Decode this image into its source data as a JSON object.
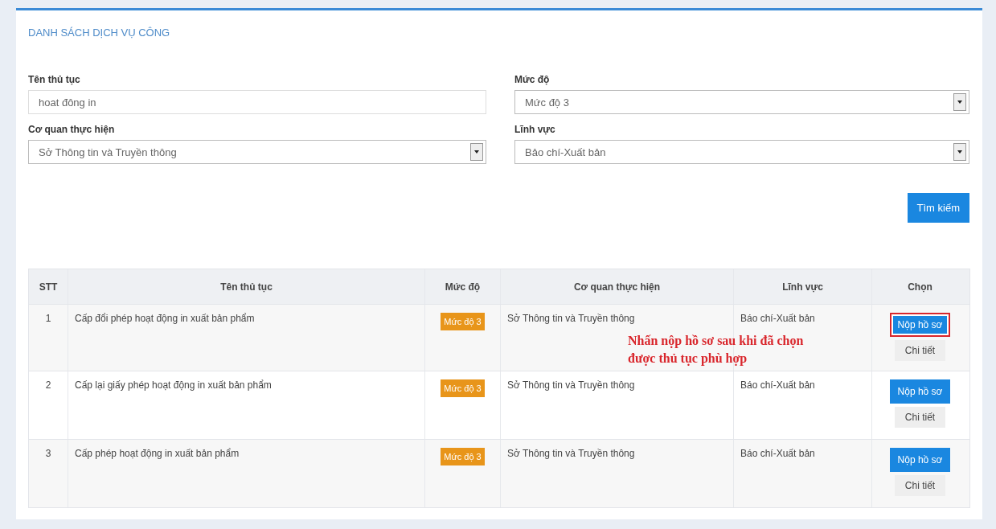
{
  "panel": {
    "title": "DANH SÁCH DỊCH VỤ CÔNG"
  },
  "filters": [
    {
      "label": "Tên thủ tục",
      "kind": "text",
      "value": "hoat đông in"
    },
    {
      "label": "Mức độ",
      "kind": "select",
      "value": "Mức độ 3"
    },
    {
      "label": "Cơ quan thực hiện",
      "kind": "select",
      "value": "Sở Thông tin và Truyền thông"
    },
    {
      "label": "Lĩnh vực",
      "kind": "select",
      "value": "Bảo chí-Xuất bản"
    }
  ],
  "search_button": "Tìm kiếm",
  "table": {
    "columns": [
      "STT",
      "Tên thủ tục",
      "Mức độ",
      "Cơ quan thực hiện",
      "Lĩnh vực",
      "Chọn"
    ],
    "rows": [
      {
        "stt": "1",
        "name": "Cấp đổi phép hoạt động in xuất bản phẩm",
        "level": "Mức độ 3",
        "agency": "Sở Thông tin và Truyền thông",
        "field": "Báo chí-Xuất bản",
        "submit": "Nộp hồ sơ",
        "detail": "Chi tiết",
        "highlighted": true
      },
      {
        "stt": "2",
        "name": "Cấp lại giấy phép hoạt động in xuất bản phẩm",
        "level": "Mức độ 3",
        "agency": "Sở Thông tin và Truyền thông",
        "field": "Báo chí-Xuất bản",
        "submit": "Nộp hồ sơ",
        "detail": "Chi tiết",
        "highlighted": false
      },
      {
        "stt": "3",
        "name": "Cấp phép hoạt động in xuất bản phẩm",
        "level": "Mức độ 3",
        "agency": "Sở Thông tin và Truyền thông",
        "field": "Báo chí-Xuất bản",
        "submit": "Nộp hồ sơ",
        "detail": "Chi tiết",
        "highlighted": false
      }
    ]
  },
  "annotation": {
    "lines": [
      "Nhấn nộp hồ sơ sau khi đã chọn",
      "được thủ tục phù hợp"
    ]
  }
}
